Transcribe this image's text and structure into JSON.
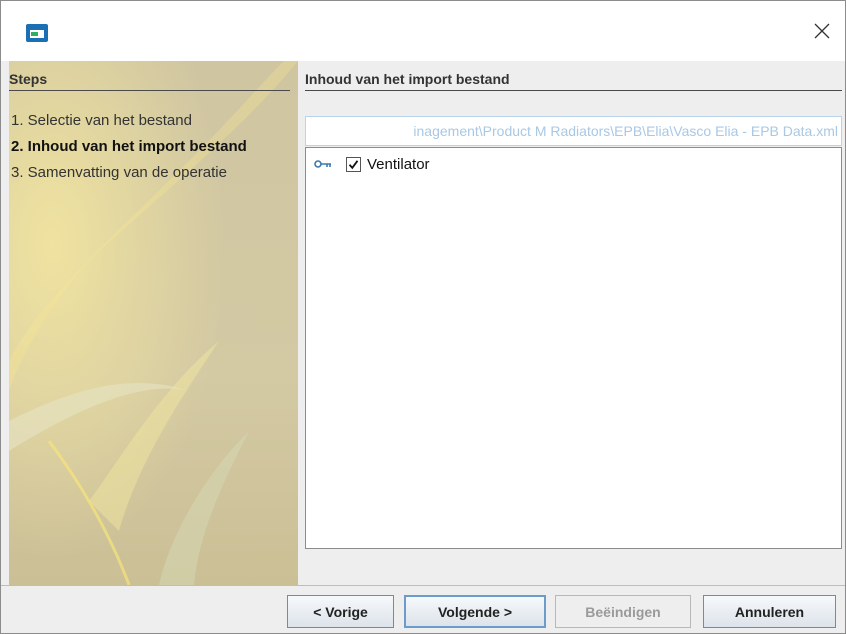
{
  "window": {
    "close_glyph": "✕"
  },
  "steps": {
    "title": "Steps",
    "items": [
      {
        "label": "1. Selectie van het bestand"
      },
      {
        "label": "2. Inhoud van het import bestand"
      },
      {
        "label": "3. Samenvatting van de operatie"
      }
    ]
  },
  "main": {
    "title": "Inhoud van het import bestand",
    "path_value": "inagement\\Product M Radiators\\EPB\\Elia\\Vasco Elia - EPB Data.xml",
    "tree": {
      "items": [
        {
          "label": "Ventilator",
          "checked": true,
          "icon": "key-icon"
        }
      ]
    }
  },
  "buttons": {
    "previous": "< Vorige",
    "next": "Volgende >",
    "finish": "Beëindigen",
    "cancel": "Annuleren"
  },
  "colors": {
    "accent": "#6c9cc9",
    "path_text": "#a8c8e4",
    "steps_tint": "#d2c7a0"
  }
}
